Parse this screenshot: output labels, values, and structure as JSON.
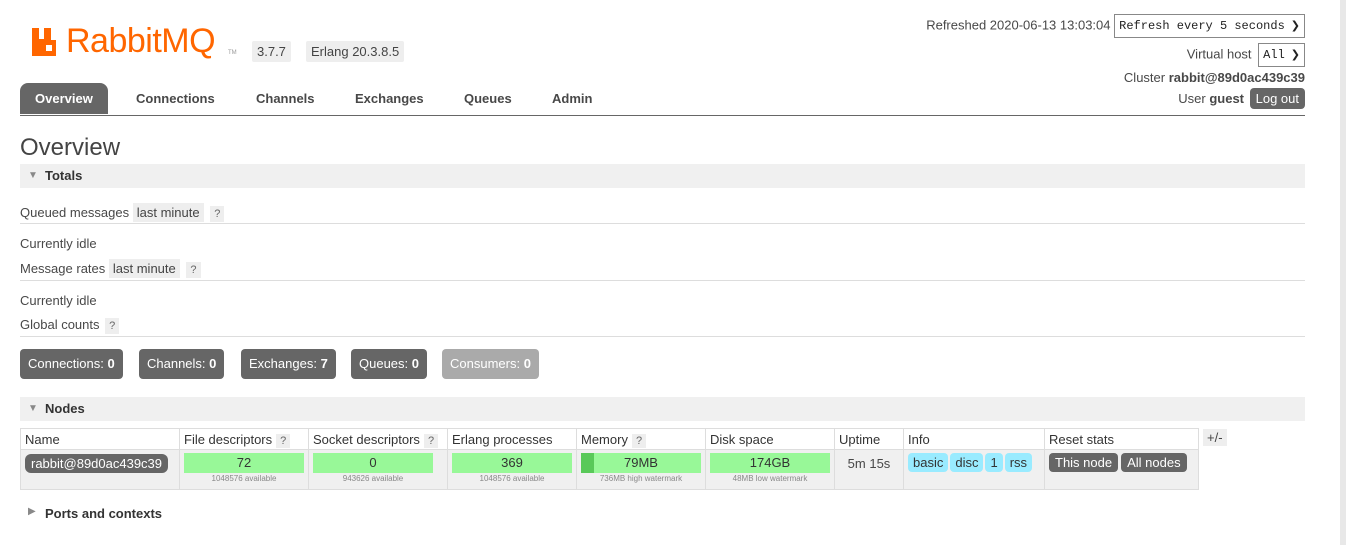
{
  "header": {
    "logo_text": "RabbitMQ",
    "logo_tm": "TM",
    "version": "3.7.7",
    "erlang": "Erlang 20.3.8.5",
    "refreshed_label": "Refreshed 2020-06-13 13:03:04",
    "refresh_select": "Refresh every 5 seconds",
    "vhost_label": "Virtual host",
    "vhost_select": "All",
    "cluster_label": "Cluster",
    "cluster_name": "rabbit@89d0ac439c39",
    "user_label": "User",
    "user_name": "guest",
    "logout_label": "Log out"
  },
  "tabs": [
    {
      "label": "Overview",
      "active": true
    },
    {
      "label": "Connections"
    },
    {
      "label": "Channels"
    },
    {
      "label": "Exchanges"
    },
    {
      "label": "Queues"
    },
    {
      "label": "Admin"
    }
  ],
  "page_title": "Overview",
  "totals": {
    "section_label": "Totals",
    "queued_label": "Queued messages",
    "queued_range": "last minute",
    "queued_help": "?",
    "queued_status": "Currently idle",
    "rates_label": "Message rates",
    "rates_range": "last minute",
    "rates_help": "?",
    "rates_status": "Currently idle",
    "global_label": "Global counts",
    "global_help": "?",
    "counts": [
      {
        "label": "Connections:",
        "value": "0"
      },
      {
        "label": "Channels:",
        "value": "0"
      },
      {
        "label": "Exchanges:",
        "value": "7"
      },
      {
        "label": "Queues:",
        "value": "0"
      },
      {
        "label": "Consumers:",
        "value": "0"
      }
    ]
  },
  "nodes": {
    "section_label": "Nodes",
    "plus_minus": "+/-",
    "columns": [
      "Name",
      "File descriptors",
      "Socket descriptors",
      "Erlang processes",
      "Memory",
      "Disk space",
      "Uptime",
      "Info",
      "Reset stats"
    ],
    "help": "?",
    "row": {
      "name": "rabbit@89d0ac439c39",
      "file_descriptors": "72",
      "file_descriptors_sub": "1048576 available",
      "socket_descriptors": "0",
      "socket_descriptors_sub": "943626 available",
      "erlang_processes": "369",
      "erlang_processes_sub": "1048576 available",
      "memory": "79MB",
      "memory_sub": "736MB high watermark",
      "memory_fraction": 0.107,
      "disk_space": "174GB",
      "disk_space_sub": "48MB low watermark",
      "uptime": "5m 15s",
      "info_tags": [
        "basic",
        "disc",
        "1",
        "rss"
      ],
      "reset_this": "This node",
      "reset_all": "All nodes"
    }
  },
  "ports": {
    "section_label": "Ports and contexts"
  },
  "colors": {
    "brand_orange": "#ff6600",
    "dark_grey": "#666666",
    "bar_green": "#98f898",
    "info_blue": "#99ebff"
  }
}
